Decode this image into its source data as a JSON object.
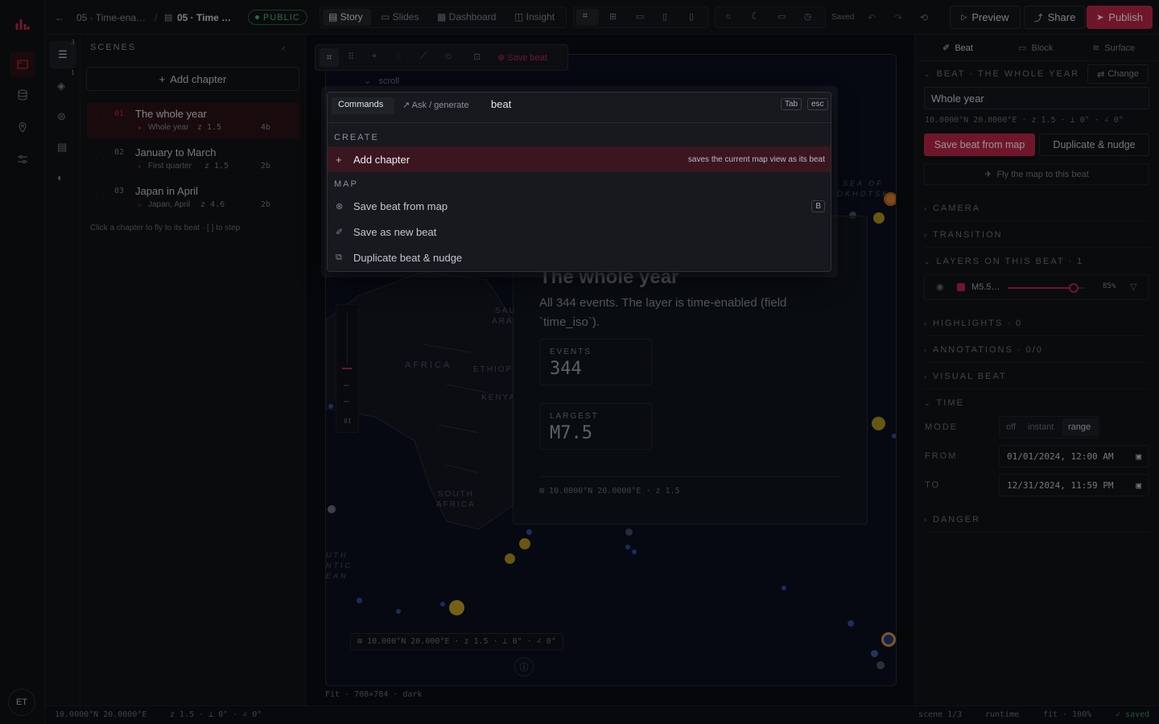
{
  "rail": {
    "avatar": "ET"
  },
  "topbar": {
    "back_crumb": "05 · Time-ena…",
    "doc_title": "05 · Time …",
    "visibility": "PUBLIC",
    "modes": [
      "Story",
      "Slides",
      "Dashboard",
      "Insight"
    ],
    "saved": "Saved",
    "preview": "Preview",
    "share": "Share",
    "publish": "Publish"
  },
  "rail2": {
    "scenes_count": "3",
    "layers_count": "1"
  },
  "scenes": {
    "header": "SCENES",
    "add_chapter": "Add chapter",
    "items": [
      {
        "num": "01",
        "title": "The whole year",
        "sub": "Whole year",
        "zoom": "z 1.5",
        "count": "4b"
      },
      {
        "num": "02",
        "title": "January to March",
        "sub": "First quarter",
        "zoom": "z 1.5",
        "count": "2b"
      },
      {
        "num": "03",
        "title": "Japan in April",
        "sub": "Japan, April",
        "zoom": "z 4.6",
        "count": "2b"
      }
    ],
    "hint": "Click a chapter to fly to its beat · [ ] to step"
  },
  "canvas": {
    "toolbar_save": "Save beat",
    "scroll_label": "scroll",
    "card_title": "The whole year",
    "card_body": "All 344 events. The layer is time-enabled (field `time_iso`).",
    "events_label": "EVENTS",
    "events_value": "344",
    "largest_label": "LARGEST",
    "largest_value": "M7.5",
    "card_coords": "10.0000°N 20.0000°E · z 1.5",
    "map_coords": "10.000°N 20.000°E · z 1.5 · ⊥ 0° · ∠ 0°",
    "footer": "Fit · 708×784 · dark",
    "zoom_label": "01",
    "places": {
      "sea": "SEA OF",
      "okhotsk": "OKHOTSK",
      "africa": "AFRICA",
      "ethiopia": "ETHIOP",
      "kenya": "KENYA",
      "sau": "SAU",
      "ara": "ARA",
      "south": "SOUTH",
      "africa2": "AFRICA",
      "atl1": "UTH",
      "atl2": "NTIC",
      "atl3": "EAN"
    }
  },
  "inspector": {
    "tabs": [
      "Beat",
      "Block",
      "Surface"
    ],
    "beat_header": "BEAT · THE WHOLE YEAR",
    "change": "Change",
    "beat_name": "Whole year",
    "beat_coords": "10.0000°N 20.0000°E · z 1.5 · ⊥ 0° · ∠ 0°",
    "save_from_map": "Save beat from map",
    "duplicate": "Duplicate & nudge",
    "fly": "Fly the map to this beat",
    "sections": {
      "camera": "CAMERA",
      "transition": "TRANSITION",
      "layers": "LAYERS ON THIS BEAT · 1",
      "highlights": "HIGHLIGHTS · 0",
      "annotations": "ANNOTATIONS · 0/0",
      "visual": "VISUAL BEAT",
      "time": "TIME",
      "danger": "DANGER"
    },
    "layer": {
      "name": "M5.5…",
      "opacity": "85%",
      "opacity_value": 0.85,
      "color": "#c2274a"
    },
    "mode_label": "MODE",
    "modes": [
      "off",
      "instant",
      "range"
    ],
    "from_label": "FROM",
    "from_value": "01/01/2024, 12:00 AM",
    "to_label": "TO",
    "to_value": "12/31/2024, 11:59 PM"
  },
  "status": {
    "left": "10.0000°N 20.0000°E",
    "mid": "z 1.5 · ⊥ 0° · ∠ 0°",
    "scene": "scene 1/3",
    "runtime": "runtime",
    "fit": "fit · 100%",
    "saved": "saved"
  },
  "palette": {
    "tab_commands": "Commands",
    "tab_ask": "Ask / generate",
    "query": "beat",
    "key_tab": "Tab",
    "key_esc": "esc",
    "group_create": "CREATE",
    "add_chapter": "Add chapter",
    "add_chapter_hint": "saves the current map view as its beat",
    "group_map": "MAP",
    "save_beat": "Save beat from map",
    "save_beat_key": "B",
    "save_new": "Save as new beat",
    "duplicate": "Duplicate beat & nudge"
  },
  "colors": {
    "accent": "#c2274a",
    "bg": "#0f1115",
    "gold": "#d4a72c",
    "orange": "#e08b2c"
  }
}
